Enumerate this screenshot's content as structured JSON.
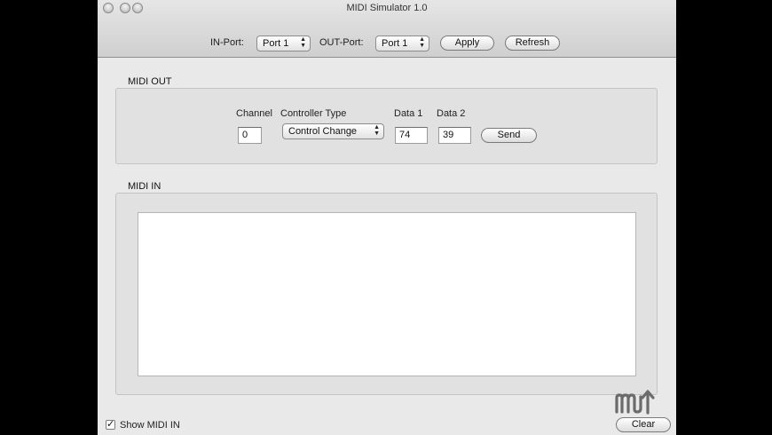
{
  "window": {
    "title": "MIDI Simulator 1.0"
  },
  "toolbar": {
    "in_port_label": "IN-Port:",
    "in_port_value": "Port 1",
    "out_port_label": "OUT-Port:",
    "out_port_value": "Port 1",
    "apply_label": "Apply",
    "refresh_label": "Refresh"
  },
  "midi_out": {
    "title": "MIDI OUT",
    "channel_label": "Channel",
    "channel_value": "0",
    "controller_type_label": "Controller Type",
    "controller_type_value": "Control Change",
    "data1_label": "Data 1",
    "data1_value": "74",
    "data2_label": "Data 2",
    "data2_value": "39",
    "send_label": "Send"
  },
  "midi_in": {
    "title": "MIDI IN"
  },
  "footer": {
    "show_midi_in_label": "Show MIDI IN",
    "show_midi_in_checked": true,
    "clear_label": "Clear"
  },
  "icons": {
    "popup_arrows": "updown-arrows-icon",
    "checkmark": "checkmark-icon",
    "watermark": "mu-logo"
  }
}
